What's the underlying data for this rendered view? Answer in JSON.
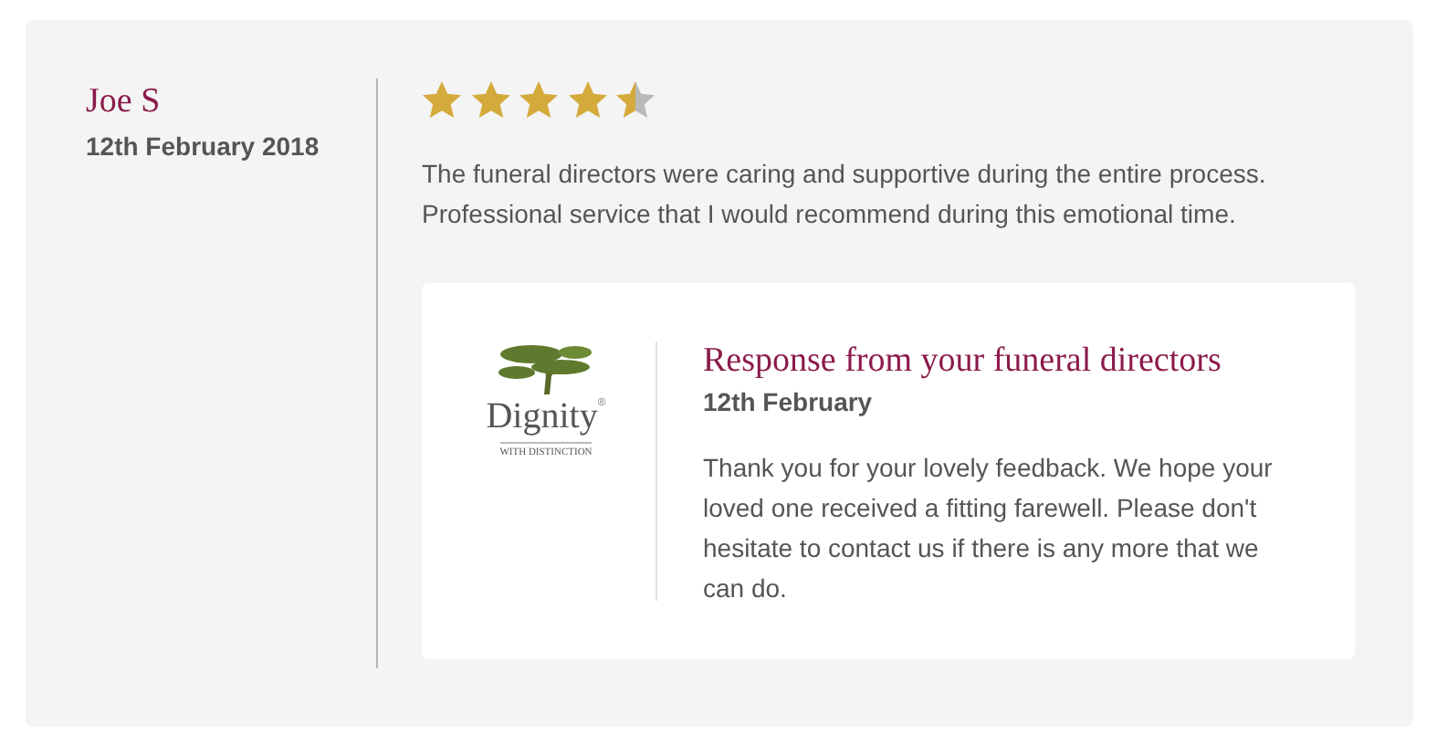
{
  "review": {
    "author": "Joe S",
    "date": "12th February 2018",
    "stars": 4.5,
    "text": "The funeral directors were caring and supportive during the entire process. Professional service that I would recommend during this emotional time."
  },
  "response": {
    "logo_name": "Dignity",
    "logo_mark": "®",
    "logo_tagline": "WITH DISTINCTION",
    "title": "Response from your funeral directors",
    "date": "12th February",
    "text": "Thank you for your lovely feedback. We hope your loved one received a fitting farewell. Please don't hesitate to contact us if there is any more that we can do."
  }
}
